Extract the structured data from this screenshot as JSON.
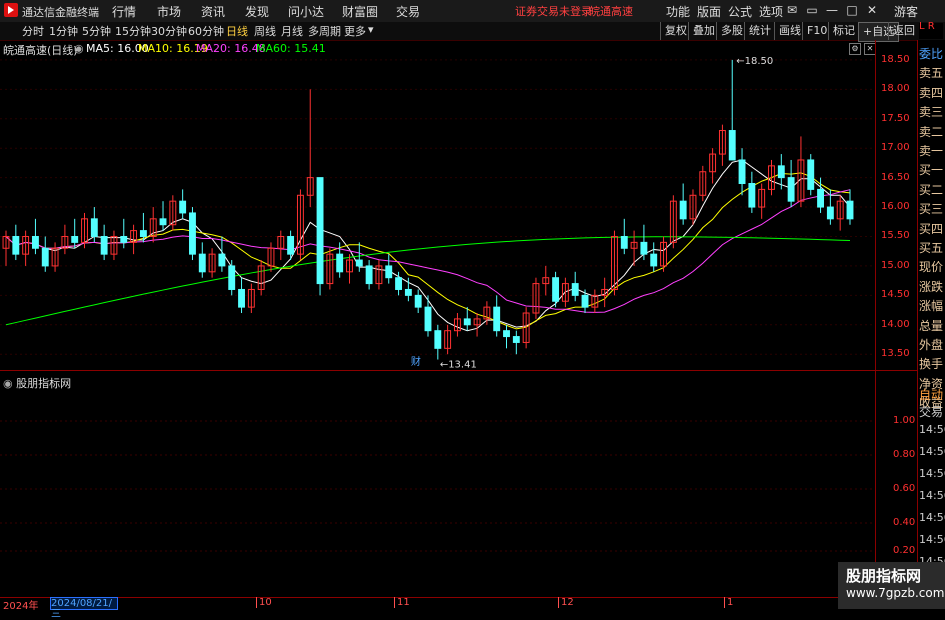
{
  "titlebar": {
    "app_name": "通达信金融终端",
    "menus": [
      "行情",
      "市场",
      "资讯",
      "发现",
      "问小达",
      "财富圈",
      "交易"
    ],
    "warning": "证券交易未登录",
    "stock": "皖通高速",
    "right_menus": [
      "功能",
      "版面",
      "公式",
      "选项"
    ],
    "guest": "游客"
  },
  "toolbar": {
    "periods": [
      "分时",
      "1分钟",
      "5分钟",
      "15分钟",
      "30分钟",
      "60分钟",
      "日线",
      "周线",
      "月线",
      "多周期",
      "更多"
    ],
    "active_period": "日线",
    "right_tools": [
      "复权",
      "叠加",
      "多股",
      "统计",
      "画线",
      "F10",
      "标记"
    ],
    "add_watch": "+自选",
    "back": "返回"
  },
  "legend": {
    "name": "皖通高速(日线)",
    "ma5": "MA5: 16.00",
    "ma10": "MA10: 16.19",
    "ma20": "MA20: 16.48",
    "ma60": "MA60: 15.41"
  },
  "colors": {
    "up": "#ff3232",
    "down": "#54ffff",
    "ma5": "#ffffff",
    "ma10": "#ffff00",
    "ma20": "#ff40ff",
    "ma60": "#00ff00",
    "axis": "#8b0000"
  },
  "right_panel": {
    "items": [
      "委比",
      "卖五",
      "卖四",
      "卖三",
      "卖二",
      "卖一",
      "买一",
      "买二",
      "买三",
      "买四",
      "买五",
      "现价",
      "涨跌",
      "涨幅",
      "总量",
      "外盘",
      "换手",
      "净资",
      "收益"
    ],
    "auto": "自动",
    "trade": "交易",
    "times": [
      "14:56",
      "14:56",
      "14:56",
      "14:56",
      "14:56",
      "14:56",
      "14:56"
    ]
  },
  "indicator": {
    "name": "股朋指标网",
    "axis": [
      "1.00",
      "0.80",
      "0.60",
      "0.40",
      "0.20"
    ]
  },
  "chart_data": {
    "type": "candlestick",
    "y_axis": [
      "18.50",
      "18.00",
      "17.50",
      "17.00",
      "16.50",
      "16.00",
      "15.50",
      "15.00",
      "14.50",
      "14.00",
      "13.50"
    ],
    "ylim": [
      13.3,
      18.6
    ],
    "high_label": "18.50",
    "low_label": "13.41",
    "fin_marker": "财",
    "x_labels": [
      "2024年",
      "10",
      "11",
      "12",
      "1"
    ],
    "selected_date": "2024/08/21/三",
    "candles": [
      [
        15.3,
        15.6,
        15.0,
        15.5
      ],
      [
        15.5,
        15.7,
        15.1,
        15.2
      ],
      [
        15.2,
        15.6,
        15.0,
        15.5
      ],
      [
        15.5,
        15.8,
        15.2,
        15.3
      ],
      [
        15.3,
        15.5,
        14.9,
        15.0
      ],
      [
        15.0,
        15.4,
        14.9,
        15.3
      ],
      [
        15.3,
        15.7,
        15.2,
        15.5
      ],
      [
        15.5,
        15.8,
        15.3,
        15.4
      ],
      [
        15.4,
        15.9,
        15.3,
        15.8
      ],
      [
        15.8,
        16.0,
        15.4,
        15.5
      ],
      [
        15.5,
        15.7,
        15.1,
        15.2
      ],
      [
        15.2,
        15.6,
        15.1,
        15.5
      ],
      [
        15.5,
        15.8,
        15.3,
        15.4
      ],
      [
        15.4,
        15.7,
        15.2,
        15.6
      ],
      [
        15.6,
        15.9,
        15.4,
        15.5
      ],
      [
        15.5,
        16.0,
        15.4,
        15.8
      ],
      [
        15.8,
        16.1,
        15.6,
        15.7
      ],
      [
        15.7,
        16.2,
        15.6,
        16.1
      ],
      [
        16.1,
        16.3,
        15.8,
        15.9
      ],
      [
        15.9,
        16.0,
        15.1,
        15.2
      ],
      [
        15.2,
        15.4,
        14.8,
        14.9
      ],
      [
        14.9,
        15.3,
        14.8,
        15.2
      ],
      [
        15.2,
        15.5,
        14.9,
        15.0
      ],
      [
        15.0,
        15.1,
        14.5,
        14.6
      ],
      [
        14.6,
        14.8,
        14.2,
        14.3
      ],
      [
        14.3,
        14.7,
        14.2,
        14.6
      ],
      [
        14.6,
        15.1,
        14.5,
        15.0
      ],
      [
        15.0,
        15.4,
        14.9,
        15.3
      ],
      [
        15.3,
        15.6,
        15.1,
        15.5
      ],
      [
        15.5,
        15.6,
        15.1,
        15.2
      ],
      [
        15.2,
        16.3,
        15.1,
        16.2
      ],
      [
        16.2,
        18.0,
        16.0,
        16.5
      ],
      [
        16.5,
        16.5,
        14.5,
        14.7
      ],
      [
        14.7,
        15.3,
        14.6,
        15.2
      ],
      [
        15.2,
        15.4,
        14.8,
        14.9
      ],
      [
        14.9,
        15.2,
        14.7,
        15.1
      ],
      [
        15.1,
        15.4,
        14.9,
        15.0
      ],
      [
        15.0,
        15.1,
        14.6,
        14.7
      ],
      [
        14.7,
        15.1,
        14.6,
        15.0
      ],
      [
        15.0,
        15.2,
        14.7,
        14.8
      ],
      [
        14.8,
        14.9,
        14.5,
        14.6
      ],
      [
        14.6,
        14.8,
        14.4,
        14.5
      ],
      [
        14.5,
        14.6,
        14.2,
        14.3
      ],
      [
        14.3,
        14.5,
        13.8,
        13.9
      ],
      [
        13.9,
        14.0,
        13.41,
        13.6
      ],
      [
        13.6,
        14.0,
        13.5,
        13.9
      ],
      [
        13.9,
        14.2,
        13.8,
        14.1
      ],
      [
        14.1,
        14.3,
        13.9,
        14.0
      ],
      [
        14.0,
        14.2,
        13.8,
        14.1
      ],
      [
        14.1,
        14.4,
        14.0,
        14.3
      ],
      [
        14.3,
        14.5,
        13.8,
        13.9
      ],
      [
        13.9,
        14.0,
        13.6,
        13.8
      ],
      [
        13.8,
        13.9,
        13.5,
        13.7
      ],
      [
        13.7,
        14.3,
        13.6,
        14.2
      ],
      [
        14.2,
        14.8,
        14.1,
        14.7
      ],
      [
        14.7,
        15.0,
        14.5,
        14.8
      ],
      [
        14.8,
        14.9,
        14.3,
        14.4
      ],
      [
        14.4,
        14.8,
        14.3,
        14.7
      ],
      [
        14.7,
        14.9,
        14.4,
        14.5
      ],
      [
        14.5,
        14.6,
        14.2,
        14.3
      ],
      [
        14.3,
        14.6,
        14.2,
        14.5
      ],
      [
        14.5,
        14.8,
        14.3,
        14.6
      ],
      [
        14.6,
        15.6,
        14.5,
        15.5
      ],
      [
        15.5,
        15.8,
        15.2,
        15.3
      ],
      [
        15.3,
        15.6,
        15.0,
        15.4
      ],
      [
        15.4,
        15.7,
        15.1,
        15.2
      ],
      [
        15.2,
        15.4,
        14.9,
        15.0
      ],
      [
        15.0,
        15.5,
        14.9,
        15.4
      ],
      [
        15.4,
        16.2,
        15.3,
        16.1
      ],
      [
        16.1,
        16.4,
        15.7,
        15.8
      ],
      [
        15.8,
        16.3,
        15.7,
        16.2
      ],
      [
        16.2,
        16.7,
        16.1,
        16.6
      ],
      [
        16.6,
        17.0,
        16.4,
        16.9
      ],
      [
        16.9,
        17.4,
        16.7,
        17.3
      ],
      [
        17.3,
        18.5,
        17.0,
        16.8
      ],
      [
        16.8,
        17.0,
        16.2,
        16.4
      ],
      [
        16.4,
        16.6,
        15.9,
        16.0
      ],
      [
        16.0,
        16.4,
        15.8,
        16.3
      ],
      [
        16.3,
        16.8,
        16.2,
        16.7
      ],
      [
        16.7,
        16.9,
        16.3,
        16.5
      ],
      [
        16.5,
        16.8,
        16.0,
        16.1
      ],
      [
        16.1,
        17.2,
        16.0,
        16.8
      ],
      [
        16.8,
        16.9,
        16.2,
        16.3
      ],
      [
        16.3,
        16.5,
        15.9,
        16.0
      ],
      [
        16.0,
        16.3,
        15.7,
        15.8
      ],
      [
        15.8,
        16.2,
        15.6,
        16.1
      ],
      [
        16.1,
        16.3,
        15.7,
        15.8
      ]
    ]
  }
}
